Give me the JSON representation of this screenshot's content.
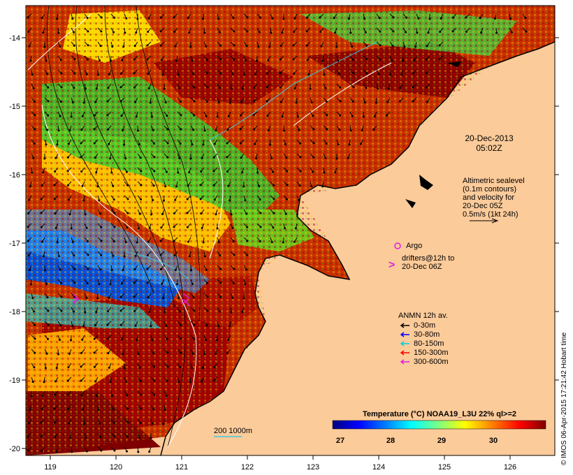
{
  "axes": {
    "x_ticks": [
      "119",
      "120",
      "121",
      "122",
      "123",
      "124",
      "125",
      "126"
    ],
    "y_ticks": [
      "-14",
      "-15",
      "-16",
      "-17",
      "-18",
      "-19",
      "-20"
    ]
  },
  "timestamp": {
    "date": "20-Dec-2013",
    "time": "05:02Z"
  },
  "altimetry_note": {
    "lines": [
      "Altimetric sealevel",
      "(0.1m contours)",
      "and velocity for",
      "20-Dec 05Z",
      "0.5m/s (1kt 24h)"
    ]
  },
  "argo": {
    "label": "Argo",
    "color": "#e020e0"
  },
  "drifters": {
    "lines": [
      "drifters@12h to",
      "20-Dec 06Z"
    ],
    "symbol": ">",
    "color": "#e020e0"
  },
  "anmn": {
    "title": "ANMN 12h av.",
    "items": [
      {
        "label": "0-30m",
        "color": "#000000"
      },
      {
        "label": "30-80m",
        "color": "#0000ff"
      },
      {
        "label": "80-150m",
        "color": "#00d0e0"
      },
      {
        "label": "150-300m",
        "color": "#ff0000"
      },
      {
        "label": "300-600m",
        "color": "#e020e0"
      }
    ]
  },
  "bathymetry": {
    "label": "200 1000m",
    "color": "#40c8e0"
  },
  "colorbar": {
    "title": "Temperature (°C) NOAA19_L3U 22% ql>=2",
    "ticks": [
      "27",
      "28",
      "29",
      "30"
    ],
    "range": [
      26.6,
      31.0
    ],
    "tick_values": [
      27,
      28,
      29,
      30
    ],
    "colors": [
      "#00007f",
      "#0000ff",
      "#007fff",
      "#00ffff",
      "#7fff7f",
      "#ffff00",
      "#ff7f00",
      "#ff0000",
      "#7f0000"
    ]
  },
  "credit": "© IMOS 06-Apr-2015 17:21:42 Hobart time",
  "colors": {
    "land": "#fccb9a",
    "frame": "#000000"
  }
}
